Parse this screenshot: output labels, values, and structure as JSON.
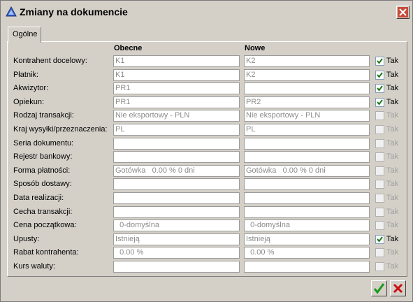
{
  "window": {
    "title": "Zmiany na dokumencie"
  },
  "tabs": [
    {
      "label": "Ogólne"
    }
  ],
  "columns": {
    "current": "Obecne",
    "new": "Nowe"
  },
  "rows": [
    {
      "label": "Kontrahent docelowy:",
      "current": "K1",
      "new": "K2",
      "checked": true,
      "check_label": "Tak",
      "enabled": true
    },
    {
      "label": "Płatnik:",
      "current": "K1",
      "new": "K2",
      "checked": true,
      "check_label": "Tak",
      "enabled": true
    },
    {
      "label": "Akwizytor:",
      "current": "PR1",
      "new": "",
      "checked": true,
      "check_label": "Tak",
      "enabled": true
    },
    {
      "label": "Opiekun:",
      "current": "PR1",
      "new": "PR2",
      "checked": true,
      "check_label": "Tak",
      "enabled": true
    },
    {
      "label": "Rodzaj transakcji:",
      "current": "Nie eksportowy - PLN",
      "new": "Nie eksportowy - PLN",
      "checked": false,
      "check_label": "Tak",
      "enabled": false
    },
    {
      "label": "Kraj wysyłki/przeznaczenia:",
      "current": "PL",
      "new": "PL",
      "checked": false,
      "check_label": "Tak",
      "enabled": false
    },
    {
      "label": "Seria dokumentu:",
      "current": "",
      "new": "",
      "checked": false,
      "check_label": "Tak",
      "enabled": false
    },
    {
      "label": "Rejestr bankowy:",
      "current": "",
      "new": "",
      "checked": false,
      "check_label": "Tak",
      "enabled": false
    },
    {
      "label": "Forma płatności:",
      "current": "Gotówka   0.00 % 0 dni",
      "new": "Gotówka   0.00 % 0 dni",
      "checked": false,
      "check_label": "Tak",
      "enabled": false
    },
    {
      "label": "Sposób dostawy:",
      "current": "",
      "new": "",
      "checked": false,
      "check_label": "Tak",
      "enabled": false
    },
    {
      "label": "Data realizacji:",
      "current": "",
      "new": "",
      "checked": false,
      "check_label": "Tak",
      "enabled": false
    },
    {
      "label": "Cecha transakcji:",
      "current": "",
      "new": "",
      "checked": false,
      "check_label": "Tak",
      "enabled": false
    },
    {
      "label": "Cena początkowa:",
      "current": "  0-domyślna",
      "new": "  0-domyślna",
      "checked": false,
      "check_label": "Tak",
      "enabled": false
    },
    {
      "label": "Upusty:",
      "current": "Istnieją",
      "new": "Istnieją",
      "checked": true,
      "check_label": "Tak",
      "enabled": true
    },
    {
      "label": "Rabat kontrahenta:",
      "current": "  0.00 %",
      "new": "  0.00 %",
      "checked": false,
      "check_label": "Tak",
      "enabled": false
    },
    {
      "label": "Kurs waluty:",
      "current": "",
      "new": "",
      "checked": false,
      "check_label": "Tak",
      "enabled": false
    }
  ],
  "buttons": {
    "ok": "check-icon",
    "cancel": "x-icon"
  },
  "colors": {
    "ok_green": "#1a9a1a",
    "cancel_red": "#cc1010",
    "close_red": "#c02a1a"
  }
}
